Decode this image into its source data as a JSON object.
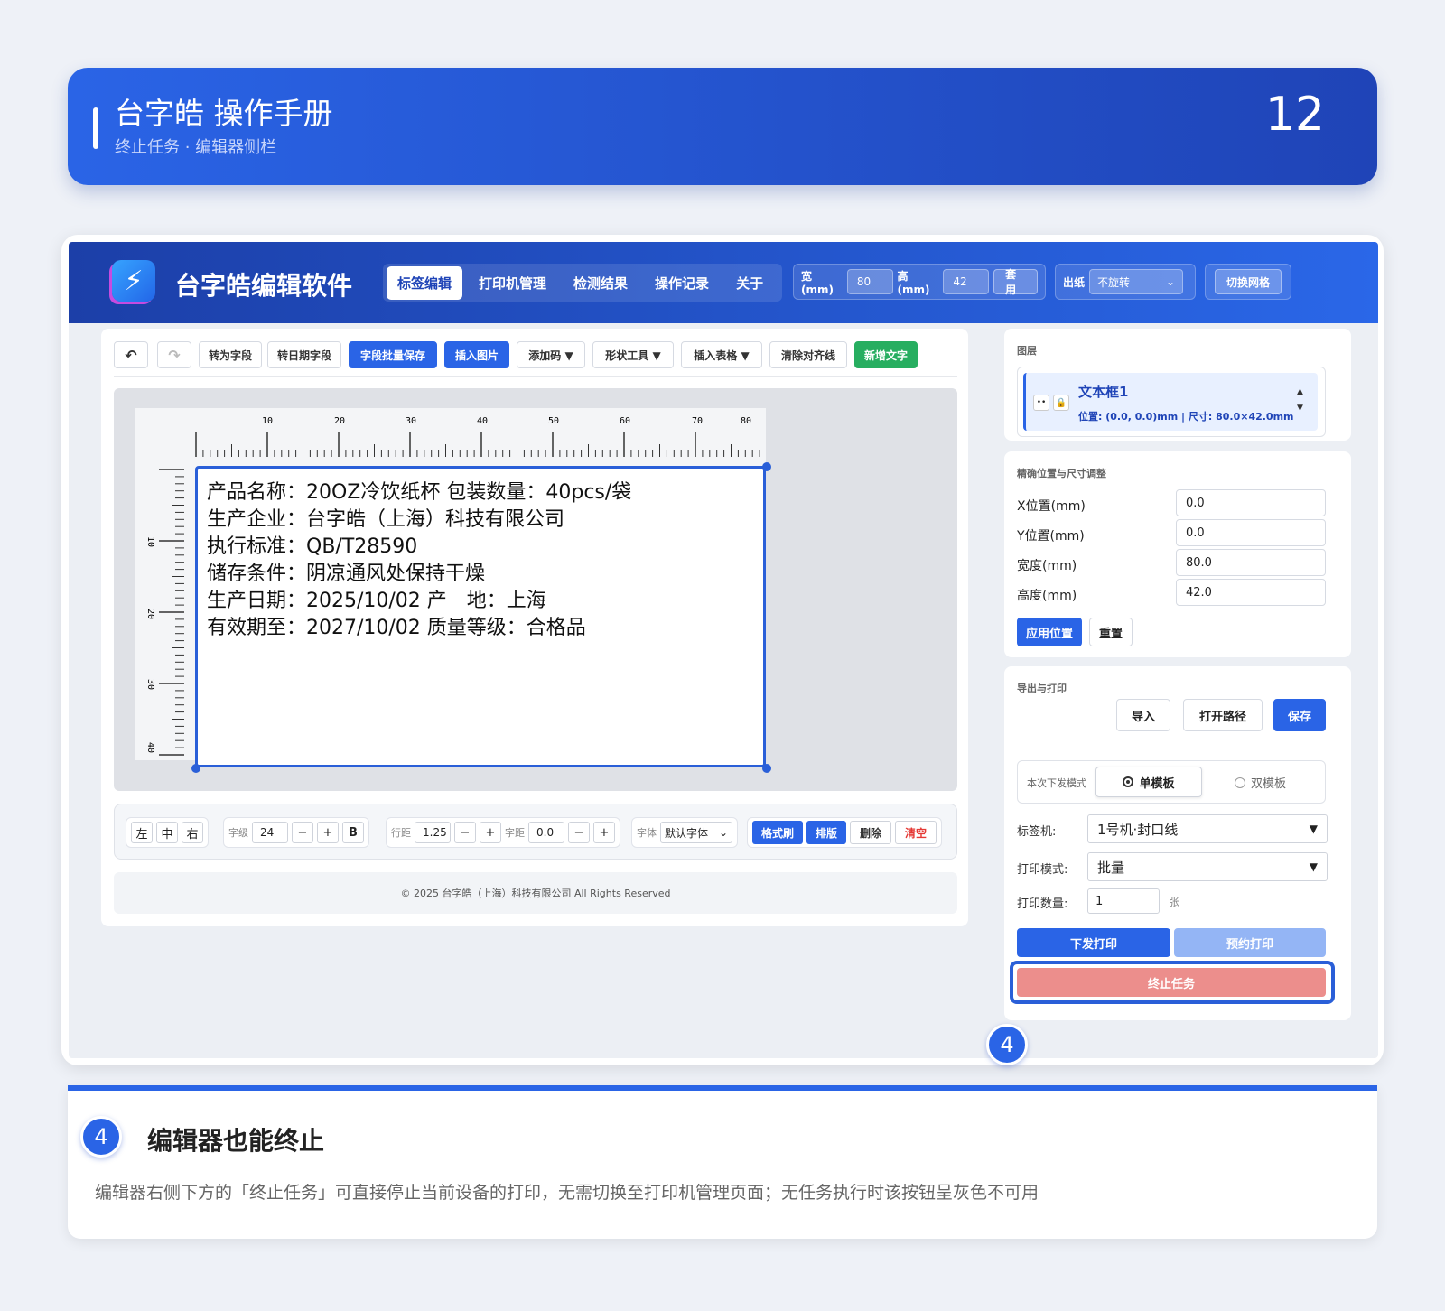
{
  "header": {
    "title": "台字皓 操作手册",
    "subtitle": "终止任务 · 编辑器侧栏",
    "page_number": "12"
  },
  "app": {
    "name": "台字皓编辑软件",
    "tabs": [
      "标签编辑",
      "打印机管理",
      "检测结果",
      "操作记录",
      "关于"
    ],
    "width_label": "宽(mm)",
    "width_value": "80",
    "height_label": "高(mm)",
    "height_value": "42",
    "apply_label": "套用",
    "paper_label": "出纸",
    "paper_value": "不旋转",
    "grid_label": "切换网格"
  },
  "toolbar": {
    "undo_icon": "undo-icon",
    "redo_icon": "redo-icon",
    "items": [
      "转为字段",
      "转日期字段",
      "字段批量保存",
      "插入图片",
      "添加码 ▼",
      "形状工具 ▼",
      "插入表格 ▼",
      "清除对齐线",
      "新增文字"
    ]
  },
  "ruler": {
    "h_ticks": [
      "10",
      "20",
      "30",
      "40",
      "50",
      "60",
      "70",
      "80"
    ],
    "v_ticks": [
      "10",
      "20",
      "30",
      "40"
    ]
  },
  "label": {
    "lines": [
      "产品名称：20OZ冷饮纸杯 包装数量：40pcs/袋",
      "生产企业：台字皓（上海）科技有限公司",
      "执行标准：QB/T28590",
      "储存条件：阴凉通风处保持干燥",
      "生产日期：2025/10/02 产　地：上海",
      "有效期至：2027/10/02 质量等级：合格品"
    ]
  },
  "format_bar": {
    "align": [
      "左",
      "中",
      "右"
    ],
    "size_label": "字级",
    "size_value": "24",
    "minus": "−",
    "plus": "+",
    "bold": "B",
    "line_label": "行距",
    "line_value": "1.25",
    "spacing_label": "字距",
    "spacing_value": "0.0",
    "font_label": "字体",
    "font_value": "默认字体",
    "format_brush": "格式刷",
    "layout": "排版",
    "delete": "删除",
    "clear": "清空"
  },
  "footer": {
    "text": "© 2025 台字皓（上海）科技有限公司 All Rights Reserved"
  },
  "layers": {
    "title": "图层",
    "name": "文本框1",
    "info": "位置: (0.0, 0.0)mm | 尺寸: 80.0×42.0mm"
  },
  "position": {
    "title": "精确位置与尺寸调整",
    "fields": [
      {
        "label": "X位置(mm)",
        "value": "0.0"
      },
      {
        "label": "Y位置(mm)",
        "value": "0.0"
      },
      {
        "label": "宽度(mm)",
        "value": "80.0"
      },
      {
        "label": "高度(mm)",
        "value": "42.0"
      }
    ],
    "apply": "应用位置",
    "reset": "重置"
  },
  "export": {
    "title": "导出与打印",
    "import": "导入",
    "open_path": "打开路径",
    "save": "保存",
    "mode_label": "本次下发模式",
    "single": "单模板",
    "double": "双模板",
    "printer_label": "标签机:",
    "printer_value": "1号机·封口线",
    "print_mode_label": "打印模式:",
    "print_mode_value": "批量",
    "qty_label": "打印数量:",
    "qty_value": "1",
    "qty_unit": "张",
    "send": "下发打印",
    "schedule": "预约打印",
    "stop": "终止任务"
  },
  "badge": "4",
  "note": {
    "title": "编辑器也能终止",
    "body": "编辑器右侧下方的「终止任务」可直接停止当前设备的打印，无需切换至打印机管理页面；无任务执行时该按钮呈灰色不可用"
  }
}
